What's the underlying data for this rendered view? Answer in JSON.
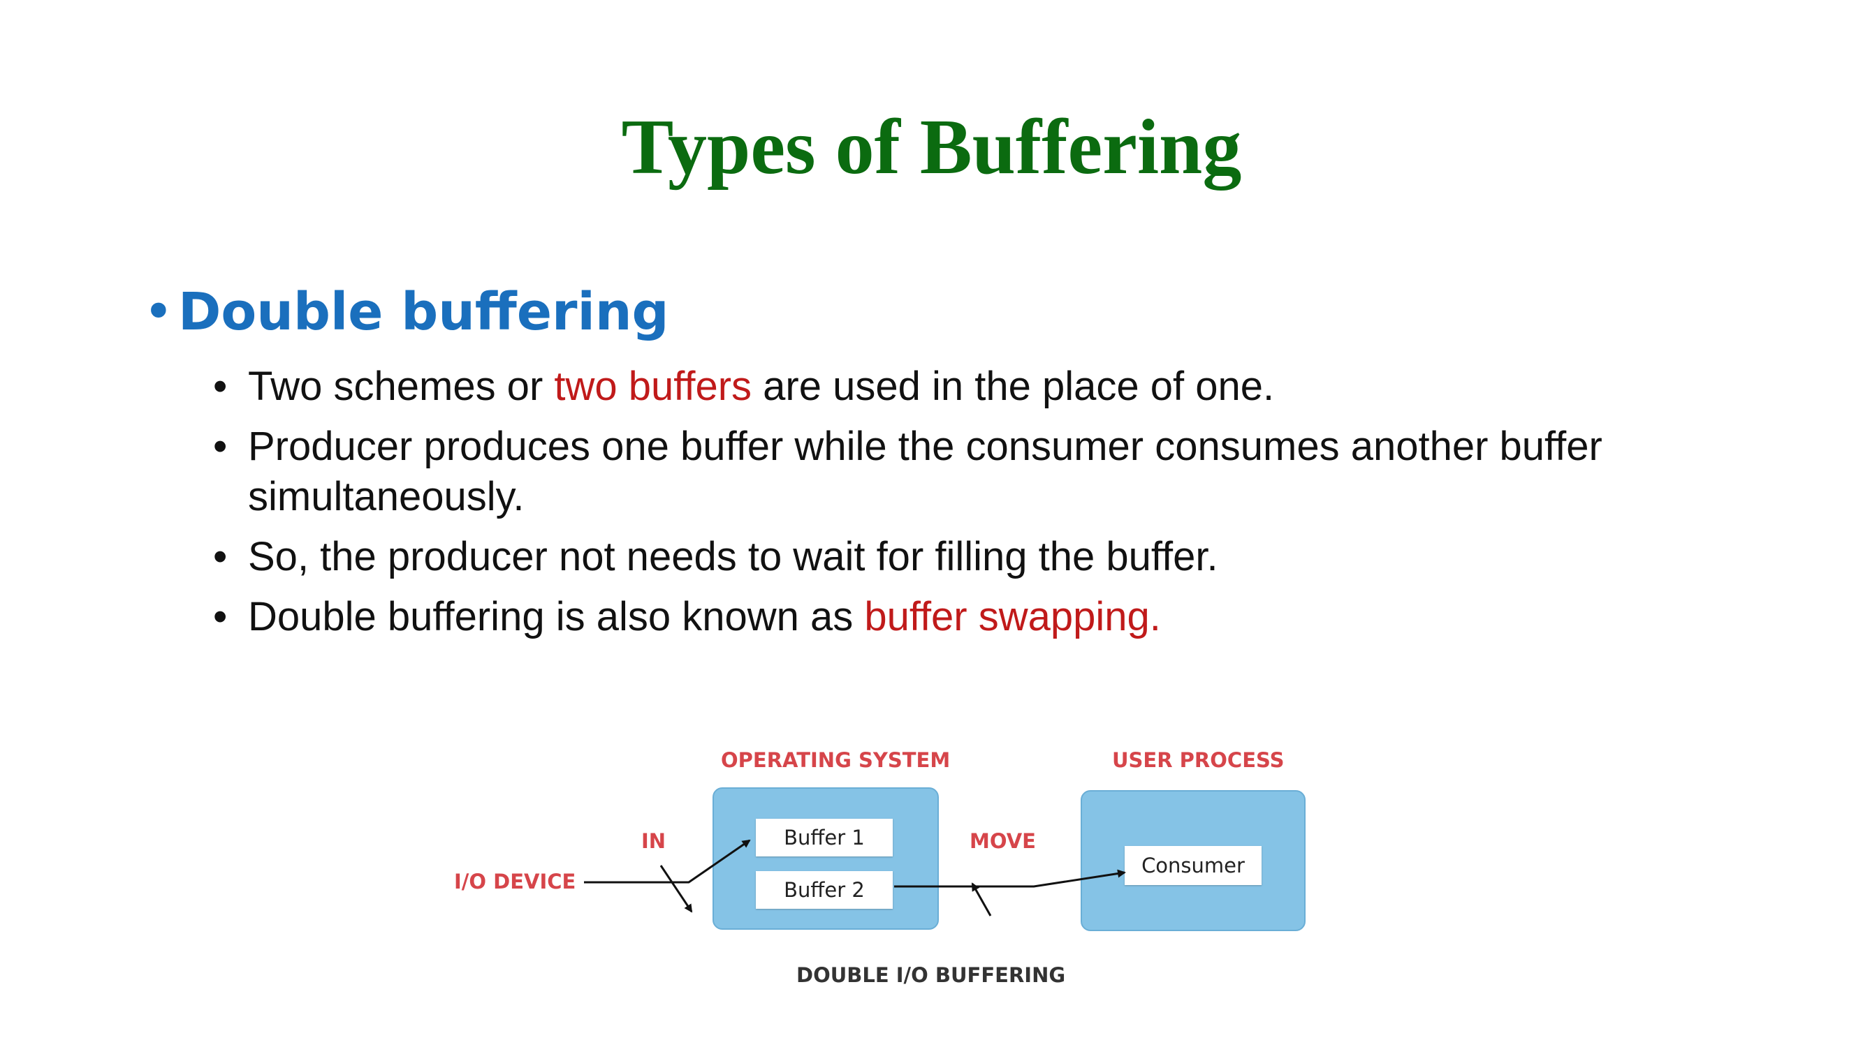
{
  "title": "Types of Buffering",
  "section": {
    "heading": "Double buffering",
    "points": [
      {
        "before": "Two schemes or ",
        "highlight": "two buffers",
        "after": " are used in the place of one."
      },
      {
        "before": "Producer produces one buffer while the consumer consumes another buffer simultaneously.",
        "highlight": "",
        "after": ""
      },
      {
        "before": "So, the producer not needs to wait for filling the buffer.",
        "highlight": "",
        "after": ""
      },
      {
        "before": "Double buffering is also known as ",
        "highlight": "buffer swapping.",
        "after": ""
      }
    ]
  },
  "diagram": {
    "os_label": "OPERATING SYSTEM",
    "user_label": "USER PROCESS",
    "io_device": "I/O DEVICE",
    "in_label": "IN",
    "move_label": "MOVE",
    "buffer1": "Buffer 1",
    "buffer2": "Buffer 2",
    "consumer": "Consumer",
    "caption": "DOUBLE I/O BUFFERING"
  },
  "colors": {
    "title": "#0b6b10",
    "heading": "#1a6fbd",
    "highlight": "#c01a1a",
    "box_fill": "#85c3e6",
    "diagram_label": "#d6454a"
  }
}
